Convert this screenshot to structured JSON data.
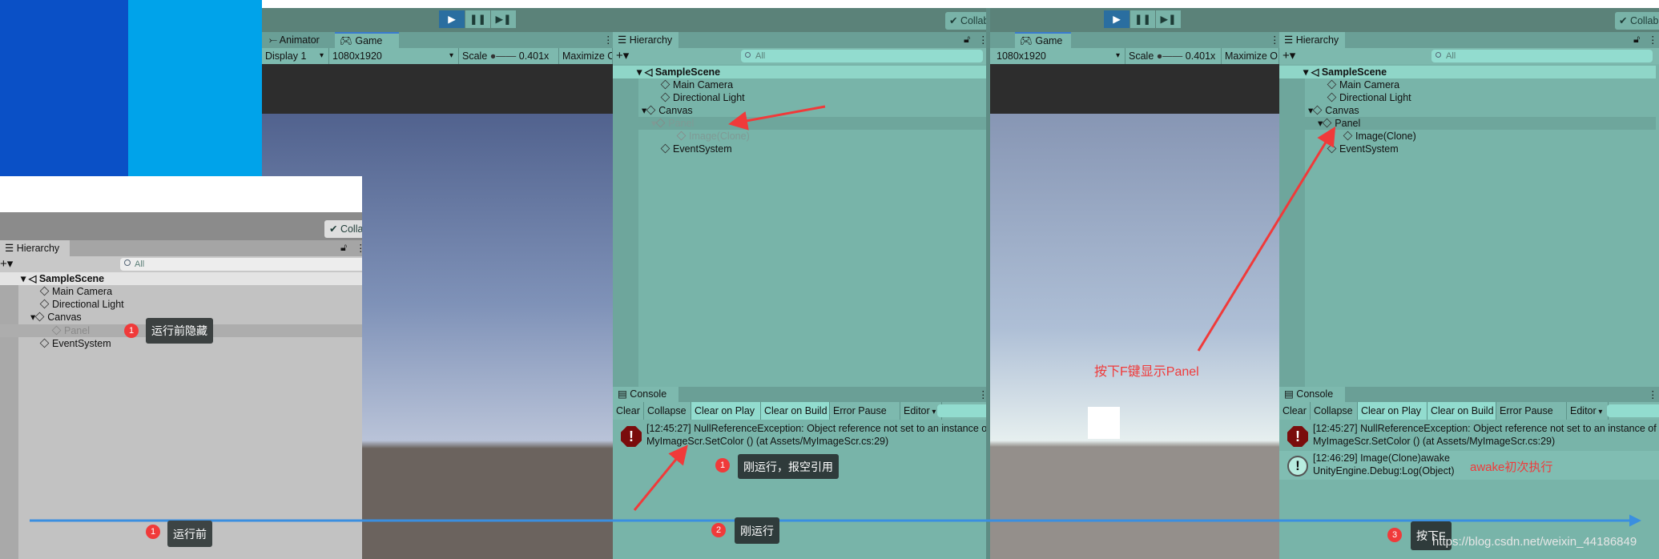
{
  "colors": {
    "accent_blue": "#2a6ea0",
    "teal_panel": "#78b4a9",
    "annotation_red": "#f03a3a",
    "timeline_blue": "#3a8fe0"
  },
  "left_window": {
    "collab": "Colla",
    "hierarchy_tab": "Hierarchy",
    "search_placeholder": "All",
    "scene": "SampleScene",
    "items": [
      "Main Camera",
      "Directional Light",
      "Canvas",
      "Panel",
      "EventSystem"
    ]
  },
  "editor_run": {
    "collab": "Collab",
    "game_tabs": [
      "Animator",
      "Game"
    ],
    "game_options": {
      "display": "Display 1",
      "resolution": "1080x1920",
      "scale_label": "Scale",
      "scale_value": "0.401x",
      "maximize": "Maximize O"
    },
    "hierarchy_tab": "Hierarchy",
    "search_placeholder": "All",
    "scene": "SampleScene",
    "items": [
      "Main Camera",
      "Directional Light",
      "Canvas",
      "Panel",
      "Image(Clone)",
      "EventSystem"
    ],
    "console": {
      "tab": "Console",
      "buttons": [
        "Clear",
        "Collapse",
        "Clear on Play",
        "Clear on Build",
        "Error Pause",
        "Editor"
      ],
      "entries": [
        {
          "type": "error",
          "line1": "[12:45:27] NullReferenceException: Object reference not set to an instance of",
          "line2": "MyImageScr.SetColor () (at Assets/MyImageScr.cs:29)"
        }
      ]
    }
  },
  "editor_press": {
    "collab": "Collab",
    "game_tabs": [
      "Game"
    ],
    "game_options": {
      "resolution": "1080x1920",
      "scale_label": "Scale",
      "scale_value": "0.401x",
      "maximize": "Maximize O"
    },
    "hierarchy_tab": "Hierarchy",
    "search_placeholder": "All",
    "scene": "SampleScene",
    "items": [
      "Main Camera",
      "Directional Light",
      "Canvas",
      "Panel",
      "Image(Clone)",
      "EventSystem"
    ],
    "console": {
      "tab": "Console",
      "buttons": [
        "Clear",
        "Collapse",
        "Clear on Play",
        "Clear on Build",
        "Error Pause",
        "Editor"
      ],
      "entries": [
        {
          "type": "error",
          "line1": "[12:45:27] NullReferenceException: Object reference not set to an instance of",
          "line2": "MyImageScr.SetColor () (at Assets/MyImageScr.cs:29)"
        },
        {
          "type": "info",
          "line1": "[12:46:29] Image(Clone)awake",
          "line2": "UnityEngine.Debug:Log(Object)"
        }
      ]
    }
  },
  "annotations": {
    "hidden_before_run": {
      "num": "1",
      "text": "运行前隐藏"
    },
    "null_ref": {
      "num": "1",
      "text": "刚运行，报空引用"
    },
    "press_f_show": "按下F键显示Panel",
    "awake_first": "awake初次执行",
    "timeline": [
      {
        "num": "1",
        "text": "运行前"
      },
      {
        "num": "2",
        "text": "刚运行"
      },
      {
        "num": "3",
        "text": "按下F"
      }
    ],
    "watermark": "https://blog.csdn.net/weixin_44186849"
  }
}
